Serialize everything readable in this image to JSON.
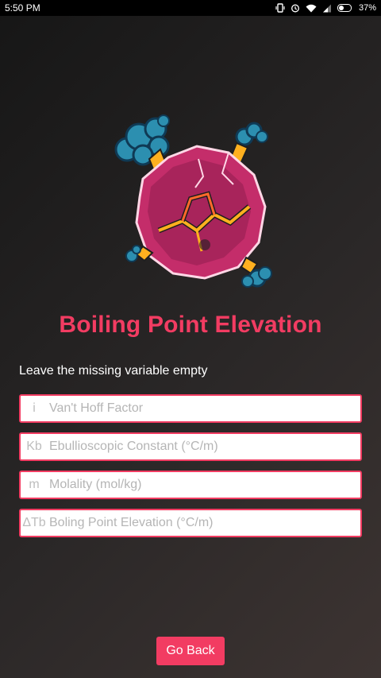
{
  "status_bar": {
    "time": "5:50 PM",
    "battery_percent": "37%",
    "icons": [
      "vibrate-icon",
      "alarm-icon",
      "wifi-icon",
      "signal-icon",
      "battery-icon"
    ]
  },
  "illustration": {
    "icon": "volcanic-rock-icon"
  },
  "title": "Boiling Point Elevation",
  "instruction": "Leave the missing variable empty",
  "fields": [
    {
      "symbol": "i",
      "placeholder": "Van't Hoff Factor",
      "value": ""
    },
    {
      "symbol": "Kb",
      "placeholder": "Ebullioscopic Constant (°C/m)",
      "value": ""
    },
    {
      "symbol": "m",
      "placeholder": "Molality (mol/kg)",
      "value": ""
    },
    {
      "symbol": "ΔTb",
      "placeholder": "Boling Point Elevation (°C/m)",
      "value": ""
    }
  ],
  "go_back_label": "Go Back",
  "colors": {
    "accent": "#f23c62",
    "background": "#232121",
    "status_bar": "#000000"
  }
}
